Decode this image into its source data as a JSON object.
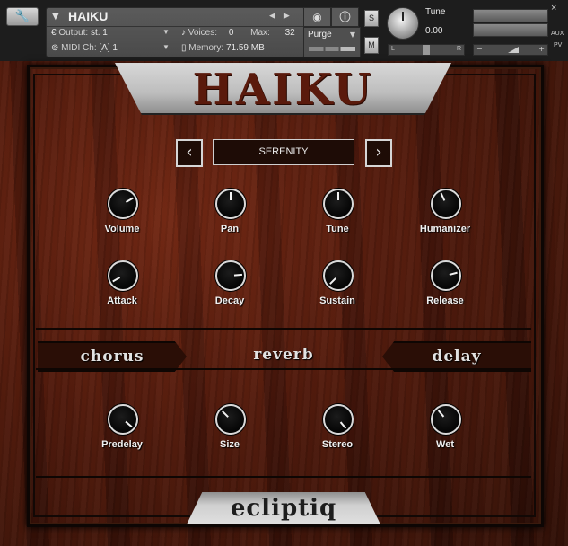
{
  "header": {
    "instrument_name": "HAIKU",
    "output_label": "Output:",
    "output_value": "st. 1",
    "voices_label": "Voices:",
    "voices_value": "0",
    "max_label": "Max:",
    "max_value": "32",
    "midi_label": "MIDI Ch:",
    "midi_value": "[A]  1",
    "memory_label": "Memory:",
    "memory_value": "71.59 MB",
    "purge_label": "Purge",
    "solo_label": "S",
    "mute_label": "M",
    "tune_label": "Tune",
    "tune_value": "0.00",
    "pan_left": "L",
    "pan_right": "R",
    "aux_label": "AUX",
    "pv_label": "PV",
    "close_label": "×"
  },
  "title": "HAIKU",
  "brand": "ecliptiq",
  "preset": {
    "name": "SERENITY",
    "prev": "‹",
    "next": "›"
  },
  "knobs": {
    "volume": {
      "label": "Volume",
      "angle": 60
    },
    "pan": {
      "label": "Pan",
      "angle": 0
    },
    "tune": {
      "label": "Tune",
      "angle": 0
    },
    "humanizer": {
      "label": "Humanizer",
      "angle": -25
    },
    "attack": {
      "label": "Attack",
      "angle": -120
    },
    "decay": {
      "label": "Decay",
      "angle": 85
    },
    "sustain": {
      "label": "Sustain",
      "angle": -135
    },
    "release": {
      "label": "Release",
      "angle": 75
    }
  },
  "fx": {
    "chorus": "chorus",
    "reverb": "reverb",
    "delay": "delay"
  },
  "fx_knobs": {
    "predelay": {
      "label": "Predelay",
      "angle": 130
    },
    "size": {
      "label": "Size",
      "angle": -45
    },
    "stereo": {
      "label": "Stereo",
      "angle": 140
    },
    "wet": {
      "label": "Wet",
      "angle": -40
    }
  }
}
